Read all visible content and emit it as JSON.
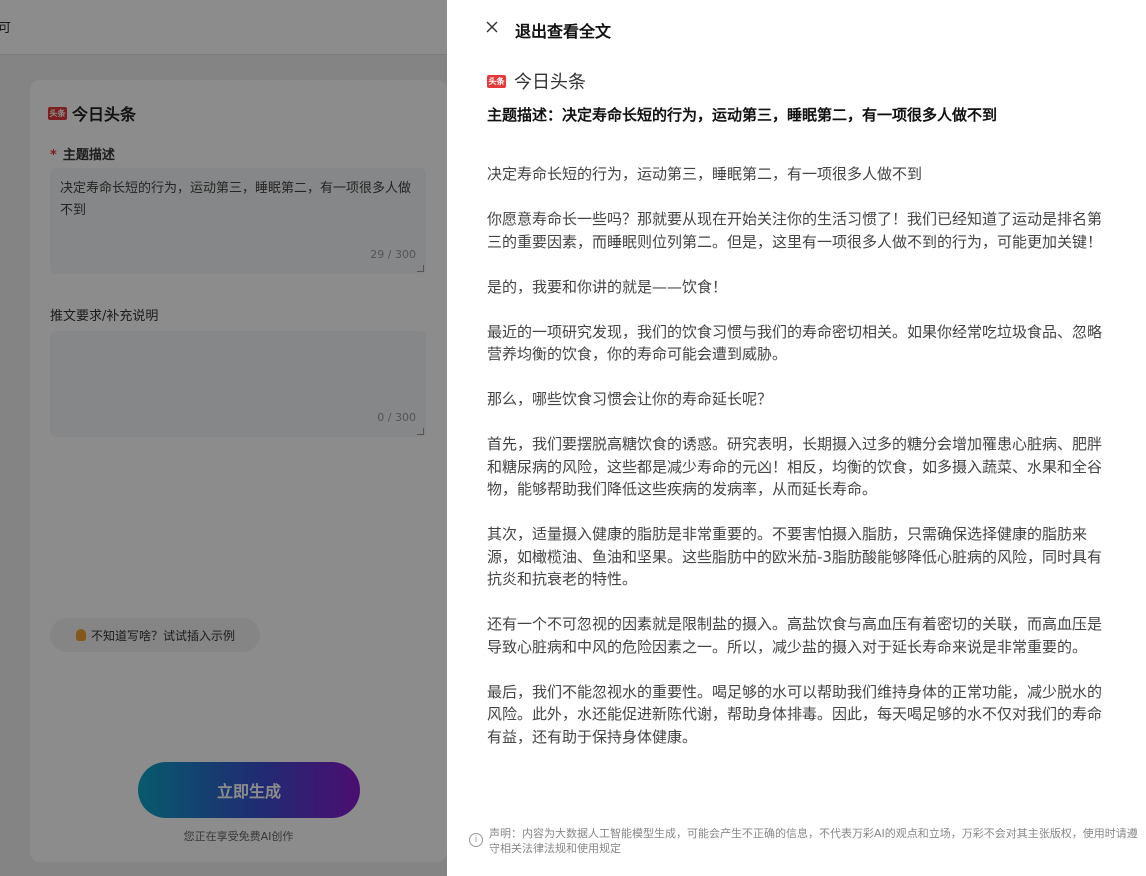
{
  "left": {
    "topbar_glyph": "可",
    "brand_logo_text": "头条",
    "brand_name": "今日头条",
    "topic_label": "主题描述",
    "required_mark": "*",
    "topic_value": "决定寿命长短的行为，运动第三，睡眠第二，有一项很多人做不到",
    "topic_counter": "29 / 300",
    "extra_label": "推文要求/补充说明",
    "extra_value": "",
    "extra_counter": "0 / 300",
    "example_label": "不知道写啥？试试插入示例",
    "generate_label": "立即生成",
    "free_note": "您正在享受免费AI创作"
  },
  "drawer": {
    "title": "退出查看全文",
    "brand_logo_text": "头条",
    "brand_name": "今日头条",
    "topic_heading": "主题描述：决定寿命长短的行为，运动第三，睡眠第二，有一项很多人做不到",
    "paragraphs": [
      "决定寿命长短的行为，运动第三，睡眠第二，有一项很多人做不到",
      "你愿意寿命长一些吗？那就要从现在开始关注你的生活习惯了！我们已经知道了运动是排名第三的重要因素，而睡眠则位列第二。但是，这里有一项很多人做不到的行为，可能更加关键！",
      "是的，我要和你讲的就是——饮食！",
      "最近的一项研究发现，我们的饮食习惯与我们的寿命密切相关。如果你经常吃垃圾食品、忽略营养均衡的饮食，你的寿命可能会遭到威胁。",
      "那么，哪些饮食习惯会让你的寿命延长呢？",
      "首先，我们要摆脱高糖饮食的诱惑。研究表明，长期摄入过多的糖分会增加罹患心脏病、肥胖和糖尿病的风险，这些都是减少寿命的元凶！相反，均衡的饮食，如多摄入蔬菜、水果和全谷物，能够帮助我们降低这些疾病的发病率，从而延长寿命。",
      "其次，适量摄入健康的脂肪是非常重要的。不要害怕摄入脂肪，只需确保选择健康的脂肪来源，如橄榄油、鱼油和坚果。这些脂肪中的欧米茄-3脂肪酸能够降低心脏病的风险，同时具有抗炎和抗衰老的特性。",
      "还有一个不可忽视的因素就是限制盐的摄入。高盐饮食与高血压有着密切的关联，而高血压是导致心脏病和中风的危险因素之一。所以，减少盐的摄入对于延长寿命来说是非常重要的。",
      "最后，我们不能忽视水的重要性。喝足够的水可以帮助我们维持身体的正常功能，减少脱水的风险。此外，水还能促进新陈代谢，帮助身体排毒。因此，每天喝足够的水不仅对我们的寿命有益，还有助于保持身体健康。"
    ],
    "info_icon_glyph": "i",
    "disclaimer": "声明：内容为大数据人工智能模型生成，可能会产生不正确的信息，不代表万彩AI的观点和立场，万彩不会对其主张版权，使用时请遵守相关法律法规和使用规定"
  }
}
